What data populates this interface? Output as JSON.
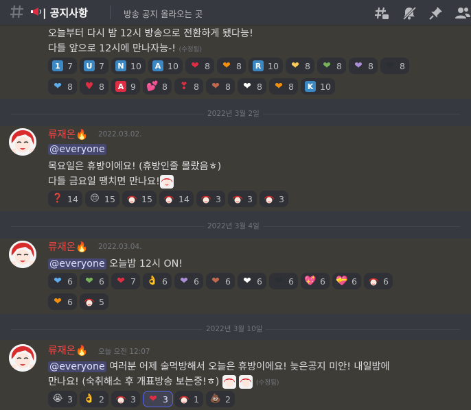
{
  "header": {
    "channel_name": "| 공지사항",
    "topic": "방송 공지 올라오는 곳"
  },
  "message0": {
    "line1": "오늘부터 다시 밤 12시 방송으로 전환하게 됐다능!",
    "line2": "다들 앞으로 12시에 만나자능-!",
    "edited": "(수정됨)",
    "reactions_row1": [
      {
        "emoji": "keycap-1",
        "glyph": "1",
        "count": "7"
      },
      {
        "emoji": "regional-u",
        "glyph": "U",
        "count": "7"
      },
      {
        "emoji": "regional-n",
        "glyph": "N",
        "count": "10"
      },
      {
        "emoji": "regional-a",
        "glyph": "A",
        "count": "10"
      },
      {
        "emoji": "red-heart",
        "glyph": "❤",
        "count": "8"
      },
      {
        "emoji": "orange-heart",
        "glyph": "❤",
        "count": "8"
      },
      {
        "emoji": "regional-r",
        "glyph": "R",
        "count": "10"
      },
      {
        "emoji": "yellow-heart",
        "glyph": "❤",
        "count": "8"
      },
      {
        "emoji": "green-heart",
        "glyph": "❤",
        "count": "8"
      },
      {
        "emoji": "purple-heart",
        "glyph": "❤",
        "count": "8"
      },
      {
        "emoji": "black-heart",
        "glyph": "❤",
        "count": "8"
      }
    ],
    "reactions_row2": [
      {
        "emoji": "blue-heart",
        "glyph": "❤",
        "count": "8"
      },
      {
        "emoji": "heavy-heart",
        "glyph": "♥",
        "count": "8"
      },
      {
        "emoji": "a-button",
        "glyph": "A",
        "count": "9"
      },
      {
        "emoji": "two-hearts",
        "glyph": "💕",
        "count": "8"
      },
      {
        "emoji": "heart-exclamation",
        "glyph": "❣",
        "count": "8"
      },
      {
        "emoji": "brown-heart",
        "glyph": "❤",
        "count": "8"
      },
      {
        "emoji": "white-heart",
        "glyph": "❤",
        "count": "8"
      },
      {
        "emoji": "heart-on-fire",
        "glyph": "❤",
        "count": "8"
      },
      {
        "emoji": "regional-k",
        "glyph": "K",
        "count": "10"
      }
    ]
  },
  "date1": "2022년 3월 2일",
  "message1": {
    "username": "류재온🔥",
    "timestamp": "2022.03.02.",
    "mention": "@everyone",
    "line1": "목요일은 휴방이에요! (휴방인줄 몰랐음ㅎ)",
    "line2": "다들 금요일 땡치면 만나요!",
    "reactions": [
      {
        "emoji": "red-question",
        "glyph": "❓",
        "count": "14"
      },
      {
        "emoji": "pensive",
        "glyph": "😔",
        "count": "15"
      },
      {
        "emoji": "custom-char-1",
        "glyph": "🎎",
        "count": "15"
      },
      {
        "emoji": "custom-char-2",
        "glyph": "🎎",
        "count": "14"
      },
      {
        "emoji": "custom-char-3",
        "glyph": "🎎",
        "count": "3"
      },
      {
        "emoji": "custom-char-4",
        "glyph": "🎎",
        "count": "3"
      },
      {
        "emoji": "custom-char-5",
        "glyph": "🎎",
        "count": "3"
      }
    ]
  },
  "date2": "2022년 3월 4일",
  "message2": {
    "username": "류재온🔥",
    "timestamp": "2022.03.04.",
    "mention": "@everyone",
    "text": " 오늘밤 12시 ON!",
    "reactions_row1": [
      {
        "emoji": "blue-heart",
        "glyph": "❤",
        "count": "6"
      },
      {
        "emoji": "green-heart",
        "glyph": "❤",
        "count": "6"
      },
      {
        "emoji": "red-heart",
        "glyph": "❤",
        "count": "7"
      },
      {
        "emoji": "ok-hand",
        "glyph": "👌",
        "count": "6"
      },
      {
        "emoji": "purple-heart",
        "glyph": "❤",
        "count": "6"
      },
      {
        "emoji": "brown-heart",
        "glyph": "❤",
        "count": "6"
      },
      {
        "emoji": "white-heart",
        "glyph": "❤",
        "count": "6"
      },
      {
        "emoji": "black-heart",
        "glyph": "❤",
        "count": "6"
      },
      {
        "emoji": "sparkling-heart",
        "glyph": "💖",
        "count": "6"
      },
      {
        "emoji": "heart-ribbon",
        "glyph": "💝",
        "count": "6"
      },
      {
        "emoji": "custom-char-1",
        "glyph": "🎎",
        "count": "6"
      }
    ],
    "reactions_row2": [
      {
        "emoji": "orange-heart",
        "glyph": "❤",
        "count": "6"
      },
      {
        "emoji": "custom-char-6",
        "glyph": "🎎",
        "count": "5"
      }
    ]
  },
  "date3": "2022년 3월 10일",
  "message3": {
    "username": "류재온🔥",
    "timestamp": "오늘 오전 12:07",
    "mention": "@everyone",
    "line1": " 여러분 어제 술먹방해서 오늘은 휴방이에요! 늦은공지 미안! 내일밤에",
    "line2": "만나요! (숙취해소 후 개표방송 보는중!ㅎ)",
    "edited": "(수정됨)",
    "reactions": [
      {
        "emoji": "sob",
        "glyph": "😭",
        "count": "3"
      },
      {
        "emoji": "ok-hand",
        "glyph": "👌",
        "count": "2"
      },
      {
        "emoji": "custom-char-4",
        "glyph": "🎎",
        "count": "3"
      },
      {
        "emoji": "red-heart",
        "glyph": "❤",
        "count": "3"
      },
      {
        "emoji": "custom-char-1",
        "glyph": "🎎",
        "count": "1"
      },
      {
        "emoji": "poop",
        "glyph": "💩",
        "count": "2"
      }
    ]
  }
}
